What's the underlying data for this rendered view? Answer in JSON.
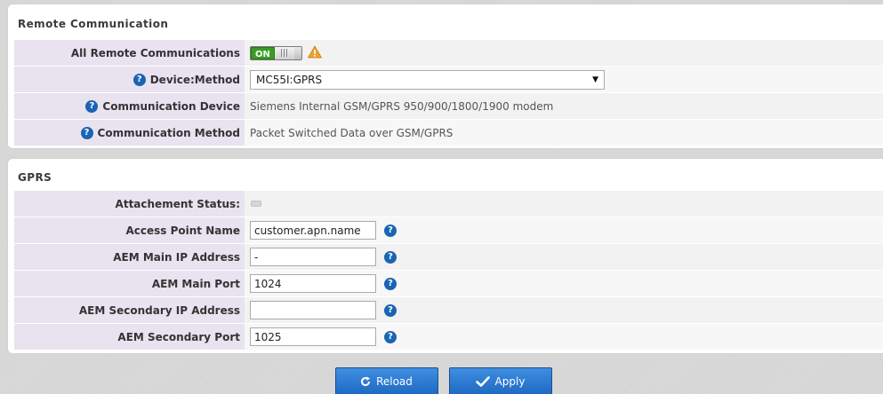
{
  "remote": {
    "title": "Remote Communication",
    "all_remote": {
      "label": "All Remote Communications",
      "toggle_text": "ON",
      "enabled": true
    },
    "device_method": {
      "label": "Device:Method",
      "selected": "MC55I:GPRS"
    },
    "communication_device": {
      "label": "Communication Device",
      "value": "Siemens Internal GSM/GPRS 950/900/1800/1900 modem"
    },
    "communication_method": {
      "label": "Communication Method",
      "value": "Packet Switched Data over GSM/GPRS"
    }
  },
  "gprs": {
    "title": "GPRS",
    "attachment_status": {
      "label": "Attachement Status:"
    },
    "access_point_name": {
      "label": "Access Point Name",
      "value": "customer.apn.name"
    },
    "aem_main_ip": {
      "label": "AEM Main IP Address",
      "value": "-"
    },
    "aem_main_port": {
      "label": "AEM Main Port",
      "value": "1024"
    },
    "aem_secondary_ip": {
      "label": "AEM Secondary IP Address",
      "value": ""
    },
    "aem_secondary_port": {
      "label": "AEM Secondary Port",
      "value": "1025"
    }
  },
  "buttons": {
    "reload": "Reload",
    "apply": "Apply"
  },
  "icons": {
    "help": "help-question-icon",
    "warning": "warning-triangle-icon",
    "reload": "reload-icon",
    "apply": "checkmark-icon"
  },
  "colors": {
    "help_blue": "#1a64b4",
    "toggle_green": "#3a9d23",
    "label_bg": "#e9e2ef",
    "button_blue": "#2a78d0",
    "warning_orange": "#f0a030"
  }
}
